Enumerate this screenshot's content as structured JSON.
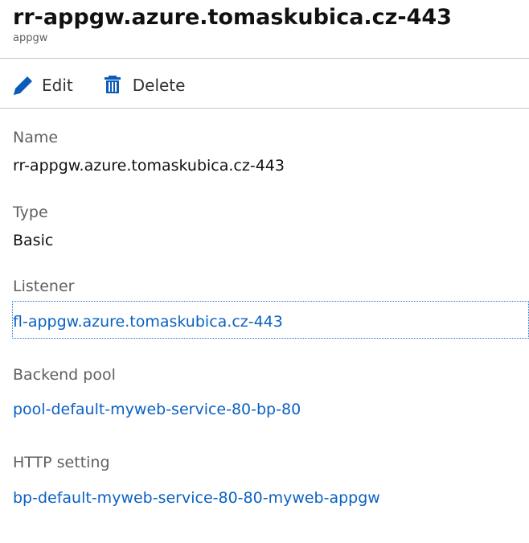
{
  "header": {
    "title": "rr-appgw.azure.tomaskubica.cz-443",
    "subtitle": "appgw"
  },
  "toolbar": {
    "edit_label": "Edit",
    "edit_icon": "pencil-icon",
    "delete_label": "Delete",
    "delete_icon": "trash-icon"
  },
  "fields": {
    "name": {
      "label": "Name",
      "value": "rr-appgw.azure.tomaskubica.cz-443"
    },
    "type": {
      "label": "Type",
      "value": "Basic"
    },
    "listener": {
      "label": "Listener",
      "value": "fl-appgw.azure.tomaskubica.cz-443"
    },
    "backend_pool": {
      "label": "Backend pool",
      "value": "pool-default-myweb-service-80-bp-80"
    },
    "http_setting": {
      "label": "HTTP setting",
      "value": "bp-default-myweb-service-80-80-myweb-appgw"
    }
  },
  "colors": {
    "accent": "#0b62c2",
    "icon": "#0b5cb8",
    "label": "#5f5f5f"
  }
}
